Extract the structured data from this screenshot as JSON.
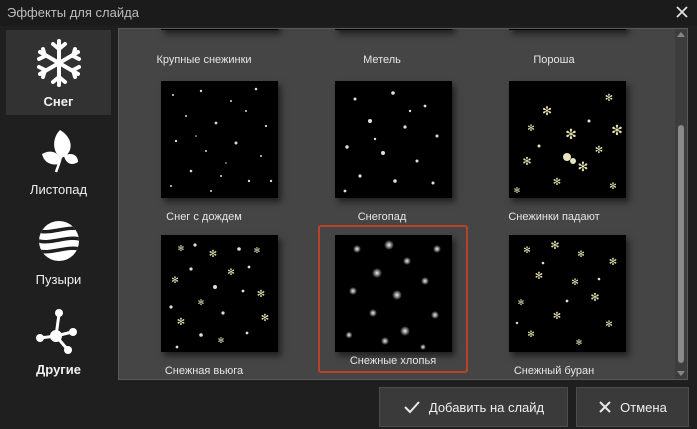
{
  "window": {
    "title": "Эффекты для слайда"
  },
  "sidebar": {
    "items": [
      {
        "label": "Снег",
        "active": true
      },
      {
        "label": "Листопад",
        "active": false
      },
      {
        "label": "Пузыри",
        "active": false
      },
      {
        "label": "Другие",
        "active": false
      }
    ]
  },
  "effects": [
    {
      "label": "Крупные снежинки"
    },
    {
      "label": "Метель"
    },
    {
      "label": "Пороша"
    },
    {
      "label": "Снег с дождем"
    },
    {
      "label": "Снегопад"
    },
    {
      "label": "Снежинки падают"
    },
    {
      "label": "Снежная вьюга"
    },
    {
      "label": "Снежные хлопья",
      "selected": true
    },
    {
      "label": "Снежный буран"
    }
  ],
  "buttons": {
    "add": "Добавить на слайд",
    "cancel": "Отмена"
  },
  "colors": {
    "selection": "#b9432a",
    "accent_snow": "#e4e0b0"
  }
}
